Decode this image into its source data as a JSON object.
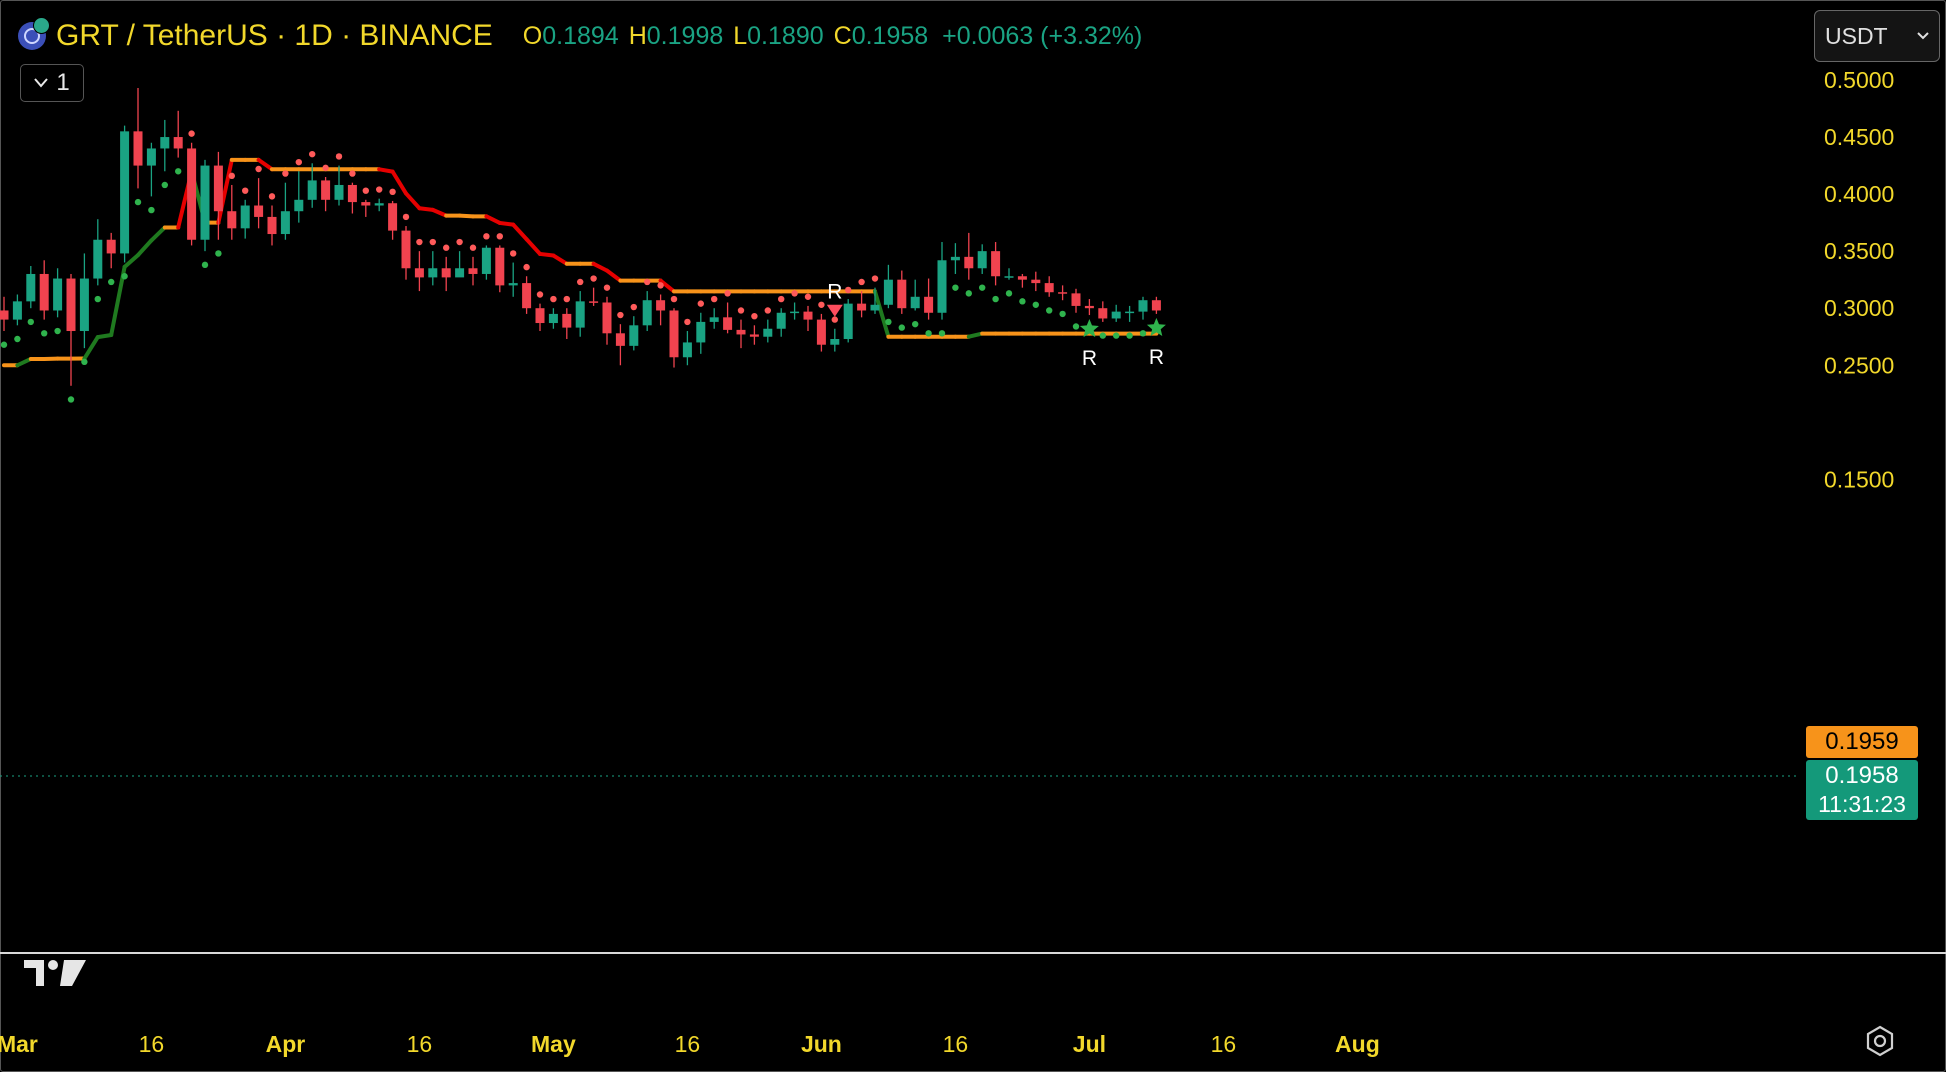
{
  "header": {
    "title": "GRT / TetherUS · 1D · BINANCE",
    "o_label": "O",
    "o_value": "0.1894",
    "h_label": "H",
    "h_value": "0.1998",
    "l_label": "L",
    "l_value": "0.1890",
    "c_label": "C",
    "c_value": "0.1958",
    "change": "+0.0063 (+3.32%)"
  },
  "indicator_toggle": {
    "label": "1"
  },
  "currency": {
    "label": "USDT"
  },
  "price_tags": {
    "orange": "0.1959",
    "green_price": "0.1958",
    "green_countdown": "11:31:23"
  },
  "colors": {
    "up": "#1aa383",
    "down": "#f0434f",
    "axis_text": "#f2d82b",
    "trail_green": "#1f7a1f",
    "trail_red": "#e60000",
    "trail_orange": "#f7931a",
    "dot_green": "#2fb34d",
    "dot_red": "#ff5a5a",
    "signal_x_red": "#ff4d5e",
    "signal_x_green": "#3ea84a"
  },
  "icons": [
    "chevron-down-icon",
    "tradingview-logo",
    "settings-hexagon-icon",
    "grt-coin-icon"
  ],
  "chart_data": {
    "type": "candlestick",
    "symbol": "GRT / TetherUS",
    "interval": "1D",
    "exchange": "BINANCE",
    "ylim": [
      0.13,
      0.51
    ],
    "y_ticks": [
      "0.5000",
      "0.4500",
      "0.4000",
      "0.3500",
      "0.3000",
      "0.2500",
      "0.1500"
    ],
    "x_ticks": [
      {
        "label": "Mar",
        "bar": 1,
        "month": true
      },
      {
        "label": "16",
        "bar": 11,
        "month": false
      },
      {
        "label": "Apr",
        "bar": 21,
        "month": true
      },
      {
        "label": "16",
        "bar": 31,
        "month": false
      },
      {
        "label": "May",
        "bar": 41,
        "month": true
      },
      {
        "label": "16",
        "bar": 51,
        "month": false
      },
      {
        "label": "Jun",
        "bar": 61,
        "month": true
      },
      {
        "label": "16",
        "bar": 71,
        "month": false
      },
      {
        "label": "Jul",
        "bar": 81,
        "month": true
      },
      {
        "label": "16",
        "bar": 91,
        "month": false
      },
      {
        "label": "Aug",
        "bar": 101,
        "month": true
      }
    ],
    "last_price": 0.1958,
    "candles": [
      [
        0.298,
        0.29,
        0.31,
        0.28
      ],
      [
        0.29,
        0.306,
        0.312,
        0.285
      ],
      [
        0.306,
        0.33,
        0.337,
        0.3
      ],
      [
        0.33,
        0.298,
        0.342,
        0.29
      ],
      [
        0.298,
        0.326,
        0.335,
        0.292
      ],
      [
        0.326,
        0.28,
        0.33,
        0.232
      ],
      [
        0.28,
        0.326,
        0.348,
        0.265
      ],
      [
        0.326,
        0.36,
        0.378,
        0.32
      ],
      [
        0.36,
        0.348,
        0.366,
        0.335
      ],
      [
        0.348,
        0.455,
        0.46,
        0.34
      ],
      [
        0.455,
        0.425,
        0.493,
        0.405
      ],
      [
        0.425,
        0.44,
        0.445,
        0.398
      ],
      [
        0.44,
        0.45,
        0.465,
        0.42
      ],
      [
        0.45,
        0.44,
        0.473,
        0.432
      ],
      [
        0.44,
        0.36,
        0.445,
        0.355
      ],
      [
        0.36,
        0.425,
        0.43,
        0.35
      ],
      [
        0.425,
        0.385,
        0.437,
        0.36
      ],
      [
        0.385,
        0.37,
        0.408,
        0.36
      ],
      [
        0.37,
        0.39,
        0.395,
        0.361
      ],
      [
        0.39,
        0.38,
        0.414,
        0.37
      ],
      [
        0.38,
        0.365,
        0.39,
        0.355
      ],
      [
        0.365,
        0.385,
        0.41,
        0.36
      ],
      [
        0.385,
        0.395,
        0.42,
        0.375
      ],
      [
        0.395,
        0.412,
        0.427,
        0.388
      ],
      [
        0.412,
        0.395,
        0.415,
        0.385
      ],
      [
        0.395,
        0.408,
        0.425,
        0.39
      ],
      [
        0.408,
        0.393,
        0.41,
        0.383
      ],
      [
        0.393,
        0.39,
        0.395,
        0.38
      ],
      [
        0.39,
        0.392,
        0.396,
        0.385
      ],
      [
        0.392,
        0.368,
        0.394,
        0.36
      ],
      [
        0.368,
        0.335,
        0.372,
        0.325
      ],
      [
        0.335,
        0.327,
        0.35,
        0.315
      ],
      [
        0.327,
        0.335,
        0.35,
        0.32
      ],
      [
        0.335,
        0.327,
        0.345,
        0.315
      ],
      [
        0.327,
        0.335,
        0.35,
        0.328
      ],
      [
        0.335,
        0.33,
        0.345,
        0.32
      ],
      [
        0.33,
        0.353,
        0.355,
        0.325
      ],
      [
        0.353,
        0.32,
        0.355,
        0.314
      ],
      [
        0.32,
        0.322,
        0.34,
        0.31
      ],
      [
        0.322,
        0.3,
        0.328,
        0.295
      ],
      [
        0.3,
        0.287,
        0.304,
        0.28
      ],
      [
        0.287,
        0.295,
        0.3,
        0.282
      ],
      [
        0.295,
        0.283,
        0.3,
        0.273
      ],
      [
        0.283,
        0.306,
        0.315,
        0.275
      ],
      [
        0.306,
        0.305,
        0.318,
        0.302
      ],
      [
        0.305,
        0.278,
        0.31,
        0.268
      ],
      [
        0.278,
        0.267,
        0.286,
        0.25
      ],
      [
        0.267,
        0.285,
        0.293,
        0.263
      ],
      [
        0.285,
        0.307,
        0.315,
        0.28
      ],
      [
        0.307,
        0.298,
        0.312,
        0.285
      ],
      [
        0.298,
        0.257,
        0.3,
        0.248
      ],
      [
        0.257,
        0.27,
        0.28,
        0.25
      ],
      [
        0.27,
        0.288,
        0.296,
        0.26
      ],
      [
        0.288,
        0.292,
        0.3,
        0.282
      ],
      [
        0.292,
        0.281,
        0.305,
        0.278
      ],
      [
        0.281,
        0.277,
        0.29,
        0.265
      ],
      [
        0.277,
        0.275,
        0.285,
        0.268
      ],
      [
        0.275,
        0.282,
        0.29,
        0.27
      ],
      [
        0.282,
        0.296,
        0.3,
        0.275
      ],
      [
        0.296,
        0.297,
        0.305,
        0.29
      ],
      [
        0.297,
        0.29,
        0.302,
        0.28
      ],
      [
        0.29,
        0.268,
        0.295,
        0.262
      ],
      [
        0.268,
        0.273,
        0.282,
        0.262
      ],
      [
        0.273,
        0.304,
        0.308,
        0.27
      ],
      [
        0.304,
        0.298,
        0.315,
        0.292
      ],
      [
        0.298,
        0.303,
        0.318,
        0.295
      ],
      [
        0.303,
        0.325,
        0.338,
        0.3
      ],
      [
        0.325,
        0.3,
        0.333,
        0.295
      ],
      [
        0.3,
        0.31,
        0.325,
        0.298
      ],
      [
        0.31,
        0.296,
        0.326,
        0.29
      ],
      [
        0.296,
        0.342,
        0.358,
        0.29
      ],
      [
        0.342,
        0.345,
        0.357,
        0.33
      ],
      [
        0.345,
        0.335,
        0.366,
        0.325
      ],
      [
        0.335,
        0.35,
        0.356,
        0.33
      ],
      [
        0.35,
        0.328,
        0.358,
        0.32
      ],
      [
        0.328,
        0.328,
        0.335,
        0.325
      ],
      [
        0.328,
        0.325,
        0.33,
        0.318
      ],
      [
        0.325,
        0.322,
        0.332,
        0.315
      ],
      [
        0.322,
        0.314,
        0.328,
        0.31
      ],
      [
        0.314,
        0.313,
        0.32,
        0.307
      ],
      [
        0.313,
        0.302,
        0.317,
        0.296
      ],
      [
        0.302,
        0.3,
        0.308,
        0.294
      ],
      [
        0.3,
        0.291,
        0.306,
        0.288
      ],
      [
        0.291,
        0.297,
        0.303,
        0.288
      ],
      [
        0.297,
        0.297,
        0.302,
        0.288
      ],
      [
        0.297,
        0.307,
        0.31,
        0.29
      ],
      [
        0.307,
        0.298,
        0.31,
        0.295
      ]
    ],
    "annotations": [
      {
        "text": "R",
        "kind": "sell-triangle",
        "bar": 62
      },
      {
        "text": "R",
        "kind": "buy-star",
        "bar": 81
      },
      {
        "text": "R",
        "kind": "buy-star",
        "bar": 93
      }
    ]
  }
}
